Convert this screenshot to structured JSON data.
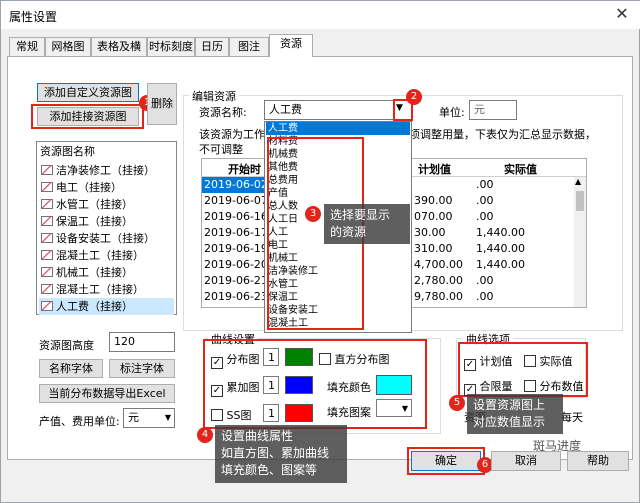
{
  "window": {
    "title": "属性设置",
    "close": "✕"
  },
  "tabs": [
    "常规",
    "网格图",
    "表格及横道",
    "时标刻度",
    "日历",
    "图注",
    "资源"
  ],
  "left": {
    "add_custom_btn": "添加自定义资源图",
    "add_linked_btn": "添加挂接资源图",
    "delete_btn": "删除",
    "list_header": "资源图名称",
    "items": [
      "洁净装修工（挂接）",
      "电工（挂接）",
      "水管工（挂接）",
      "保温工（挂接）",
      "设备安装工（挂接）",
      "混凝土工（挂接）",
      "机械工（挂接）",
      "混凝土工（挂接）",
      "人工费（挂接）"
    ],
    "height_label": "资源图高度",
    "height_value": "120",
    "name_font_btn": "名称字体",
    "axis_font_btn": "标注字体",
    "export_btn": "当前分布数据导出Excel",
    "unit_label": "产值、费用单位:",
    "unit_value": "元"
  },
  "edit": {
    "group_title": "编辑资源",
    "name_label": "资源名称:",
    "name_value": "人工费",
    "unit_label": "单位:",
    "unit_value": "元",
    "desc_line1": "该资源为工作Ⅰ",
    "desc_line1_tail": "项调整用量，下表仅为汇总显示数据，",
    "desc_line2": "不可调整",
    "table_headers": [
      "开始时",
      "计划值",
      "实际值"
    ],
    "rows": [
      {
        "date": "2019-06-02",
        "plan": "",
        "actual": ".00"
      },
      {
        "date": "2019-06-07",
        "plan": "390.00",
        "actual": ".00"
      },
      {
        "date": "2019-06-16",
        "plan": "070.00",
        "actual": ".00"
      },
      {
        "date": "2019-06-17",
        "plan": "30.00",
        "actual": "1,440.00"
      },
      {
        "date": "2019-06-19",
        "plan": "310.00",
        "actual": "1,440.00"
      },
      {
        "date": "2019-06-20",
        "plan": "4,700.00",
        "actual": "1,440.00"
      },
      {
        "date": "2019-06-21",
        "plan": "2,780.00",
        "actual": ".00"
      },
      {
        "date": "2019-06-23",
        "plan": "9,780.00",
        "actual": ".00"
      }
    ],
    "dropdown": [
      "人工费",
      "材料费",
      "机械费",
      "其他费",
      "总费用",
      "产值",
      "总人数",
      "人工日",
      "人工",
      "电工",
      "机械工",
      "洁净装修工",
      "水管工",
      "保温工",
      "设备安装工",
      "混凝土工"
    ]
  },
  "curve": {
    "group_title": "曲线设置",
    "dist_label": "分布图",
    "dist_width": "1",
    "dist_color": "#008000",
    "hist_label": "直方分布图",
    "cum_label": "累加图",
    "cum_width": "1",
    "cum_color": "#0000ff",
    "fill_color_label": "填充颜色",
    "fill_color": "#00ffff",
    "ss_label": "SS图",
    "ss_width": "1",
    "ss_color": "#ff0000",
    "fill_pattern_label": "填充图案"
  },
  "options": {
    "group_title": "曲线选项",
    "plan_label": "计划值",
    "actual_label": "实际值",
    "total_label": "合限量",
    "dist_value_label": "分布数值",
    "partial_left": "资源",
    "partial_right": "每天"
  },
  "annotations": {
    "n1": "1",
    "n2": "2",
    "n3": "3",
    "n4": "4",
    "n5": "5",
    "n6": "6",
    "note3": [
      "选择要显示",
      "的资源"
    ],
    "note4": [
      "设置曲线属性",
      "如直方图、累加曲线",
      "填充颜色、图案等"
    ],
    "note5": [
      "设置资源图上",
      "对应数值显示"
    ]
  },
  "footer": {
    "ok": "确定",
    "cancel": "取消",
    "help": "帮助"
  },
  "watermark": "斑马进度",
  "colors": {
    "highlight": "#e3241b",
    "accent": "#0078d7",
    "selected_row": "#0078d7"
  }
}
